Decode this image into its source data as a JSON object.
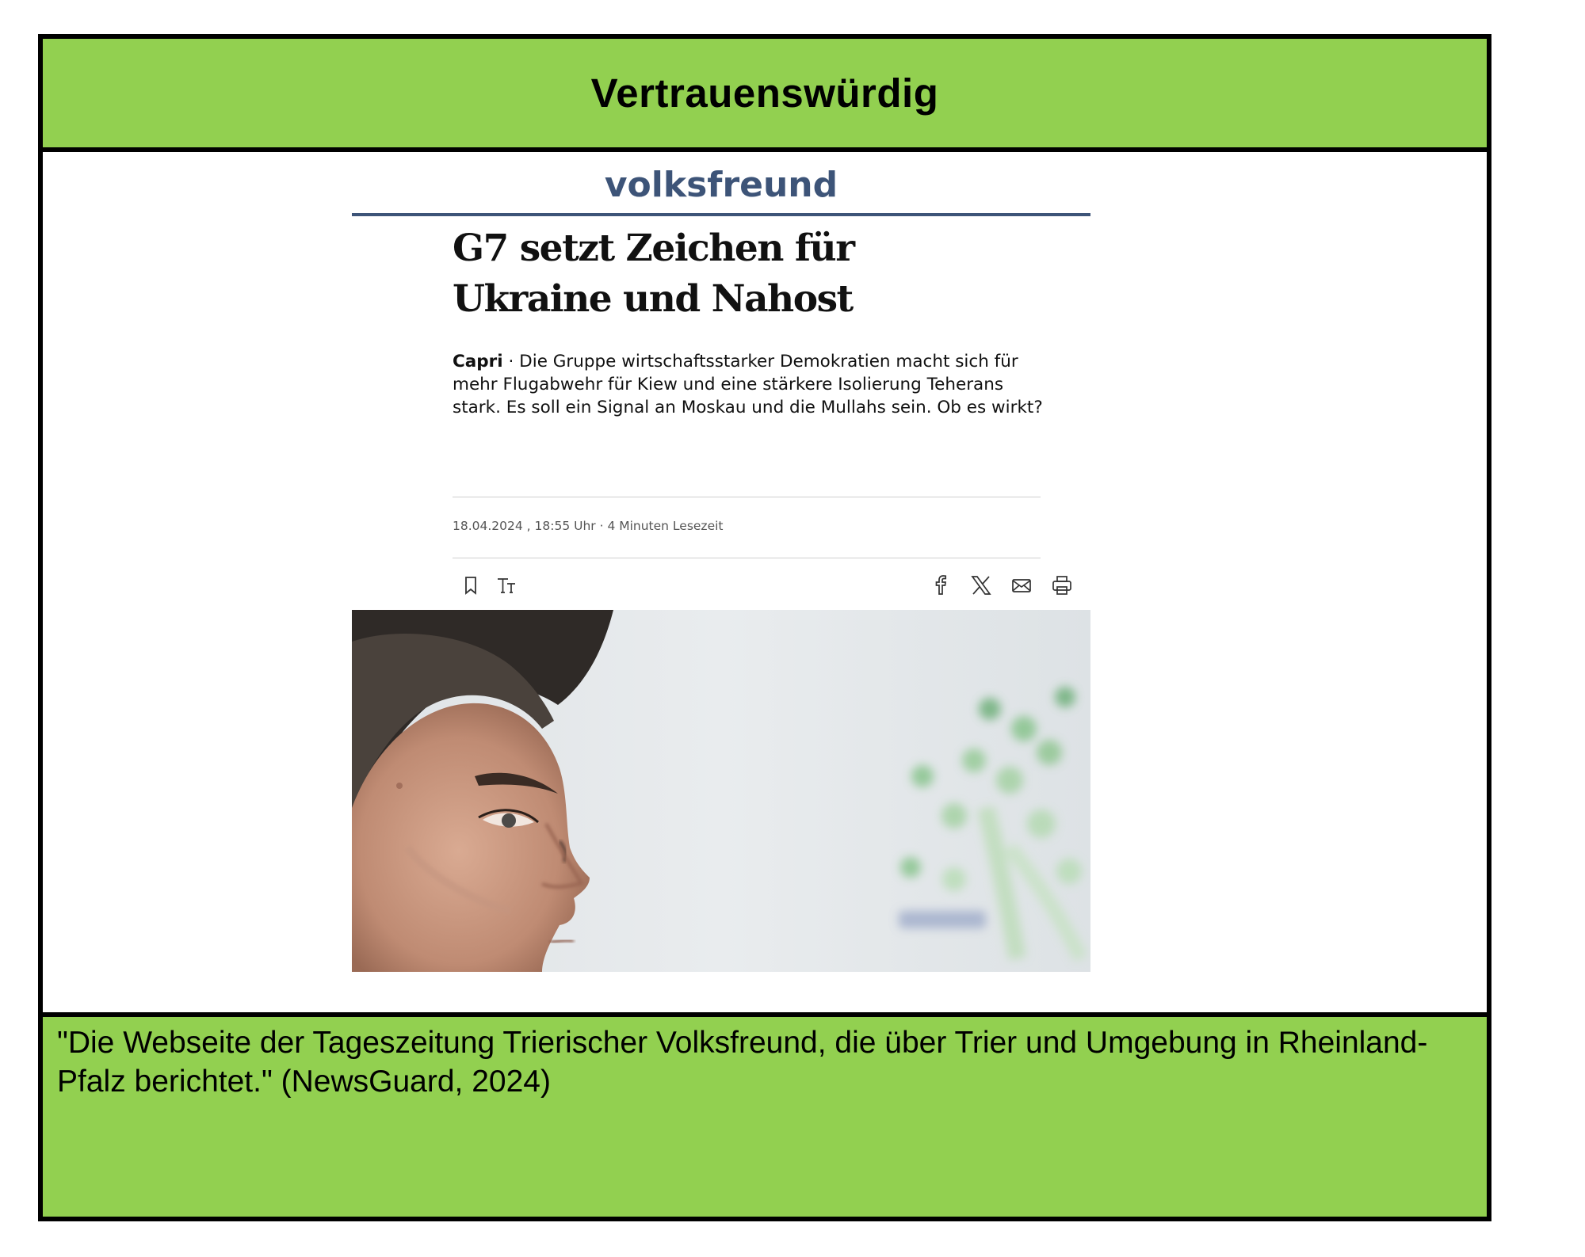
{
  "header": {
    "title": "Vertrauenswürdig"
  },
  "article": {
    "brand": "volksfreund",
    "headline": "G7 setzt Zeichen für Ukraine und Nahost",
    "dateline": "Capri",
    "separator": " · ",
    "teaser": "Die Gruppe wirtschaftsstarker Demokratien macht sich für mehr Flugabwehr für Kiew und eine stärkere Isolierung Teherans stark. Es soll ein Signal an Moskau und die Mullahs sein. Ob es wirkt?",
    "meta": "18.04.2024 , 18:55 Uhr · 4 Minuten Lesezeit",
    "toolbar_left": [
      "bookmark-icon",
      "text-size-icon"
    ],
    "toolbar_right": [
      "facebook-icon",
      "x-icon",
      "mail-icon",
      "print-icon"
    ]
  },
  "footer": {
    "quote": "\"Die Webseite der Tageszeitung Trierischer Volksfreund, die über Trier und Umgebung in Rheinland-Pfalz berichtet.\" (NewsGuard, 2024)"
  },
  "colors": {
    "band": "#92d050",
    "brand": "#3d5478",
    "border": "#000000"
  }
}
